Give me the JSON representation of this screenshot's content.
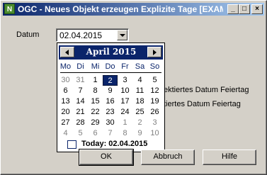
{
  "window": {
    "app_icon": "N",
    "title": "OGC - Neues Objekt erzeugen Explizite Tage [EXAM...",
    "controls": {
      "minimize": "_",
      "maximize": "□",
      "close": "×"
    }
  },
  "form": {
    "date_label": "Datum",
    "date_value": "02.04.2015",
    "option1_partial": "ektiertes Datum Feiertag",
    "option2_partial": "tiertes Datum Feiertag"
  },
  "calendar": {
    "month_title": "April 2015",
    "weekdays": [
      "Mo",
      "Di",
      "Mi",
      "Do",
      "Fr",
      "Sa",
      "So"
    ],
    "weeks": [
      [
        "30",
        "31",
        "1",
        "2",
        "3",
        "4",
        "5"
      ],
      [
        "6",
        "7",
        "8",
        "9",
        "10",
        "11",
        "12"
      ],
      [
        "13",
        "14",
        "15",
        "16",
        "17",
        "18",
        "19"
      ],
      [
        "20",
        "21",
        "22",
        "23",
        "24",
        "25",
        "26"
      ],
      [
        "27",
        "28",
        "29",
        "30",
        "1",
        "2",
        "3"
      ],
      [
        "4",
        "5",
        "6",
        "7",
        "8",
        "9",
        "10"
      ]
    ],
    "today_label": "Today: 02.04.2015"
  },
  "buttons": {
    "ok": "OK",
    "cancel": "Abbruch",
    "help": "Hilfe"
  }
}
